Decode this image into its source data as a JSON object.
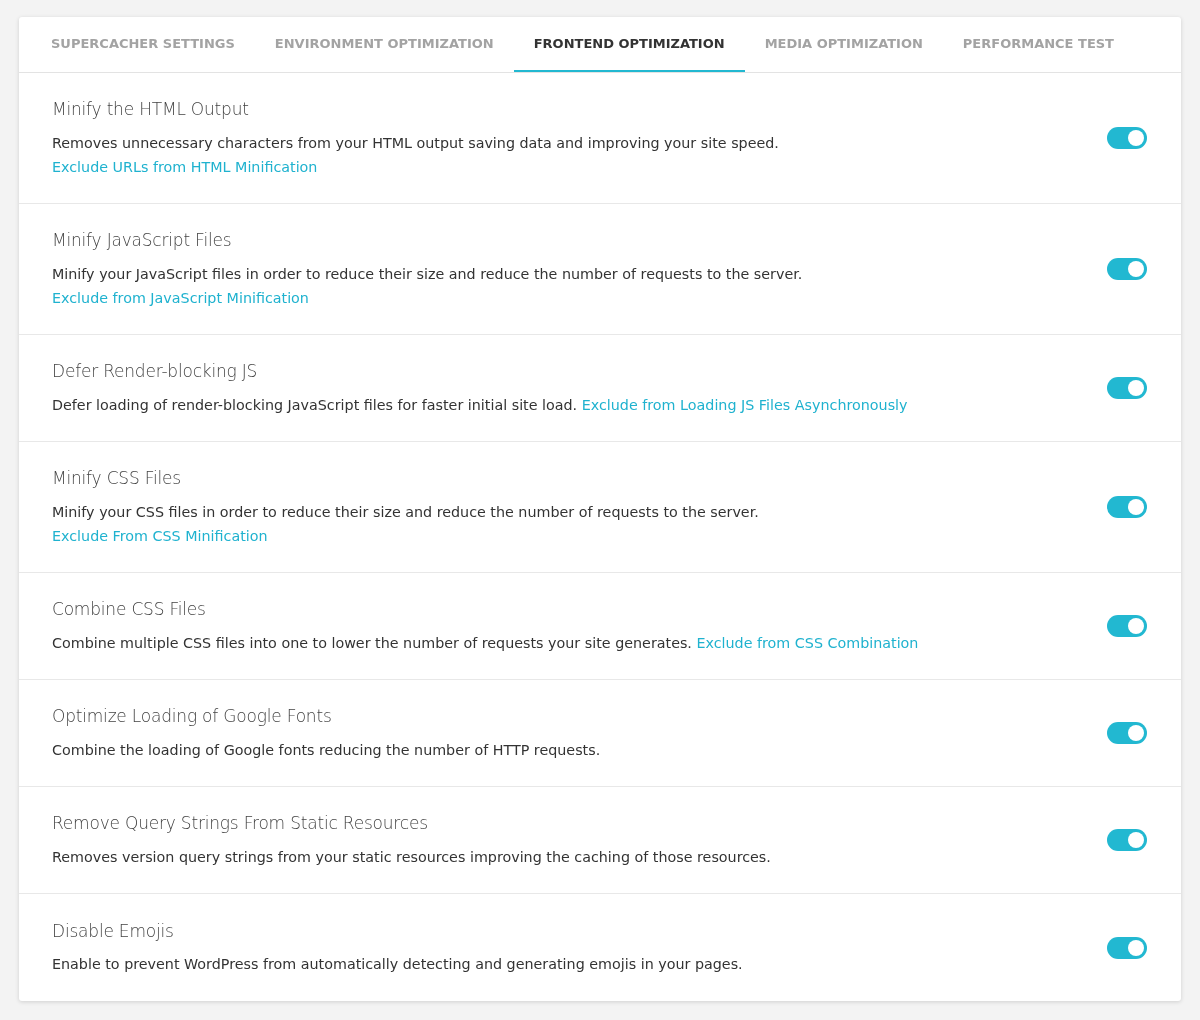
{
  "tabs": [
    {
      "label": "SUPERCACHER SETTINGS",
      "selected": false
    },
    {
      "label": "ENVIRONMENT OPTIMIZATION",
      "selected": false
    },
    {
      "label": "FRONTEND OPTIMIZATION",
      "selected": true
    },
    {
      "label": "MEDIA OPTIMIZATION",
      "selected": false
    },
    {
      "label": "PERFORMANCE TEST",
      "selected": false
    }
  ],
  "settings": [
    {
      "title": "Minify the HTML Output",
      "description": "Removes unnecessary characters from your HTML output saving data and improving your site speed.",
      "link": {
        "text": "Exclude URLs from HTML Minification",
        "inline": false
      },
      "on": true
    },
    {
      "title": "Minify JavaScript Files",
      "description": "Minify your JavaScript files in order to reduce their size and reduce the number of requests to the server.",
      "link": {
        "text": "Exclude from JavaScript Minification",
        "inline": false
      },
      "on": true
    },
    {
      "title": "Defer Render-blocking JS",
      "description": "Defer loading of render-blocking JavaScript files for faster initial site load.",
      "link": {
        "text": "Exclude from Loading JS Files Asynchronously",
        "inline": true
      },
      "on": true
    },
    {
      "title": "Minify CSS Files",
      "description": "Minify your CSS files in order to reduce their size and reduce the number of requests to the server.",
      "link": {
        "text": "Exclude From CSS Minification",
        "inline": false
      },
      "on": true
    },
    {
      "title": "Combine CSS Files",
      "description": "Combine multiple CSS files into one to lower the number of requests your site generates.",
      "link": {
        "text": "Exclude from CSS Combination",
        "inline": true
      },
      "on": true
    },
    {
      "title": "Optimize Loading of Google Fonts",
      "description": "Combine the loading of Google fonts reducing the number of HTTP requests.",
      "on": true
    },
    {
      "title": "Remove Query Strings From Static Resources",
      "description": "Removes version query strings from your static resources improving the caching of those resources.",
      "on": true
    },
    {
      "title": "Disable Emojis",
      "description": "Enable to prevent WordPress from automatically detecting and generating emojis in your pages.",
      "on": true
    }
  ]
}
